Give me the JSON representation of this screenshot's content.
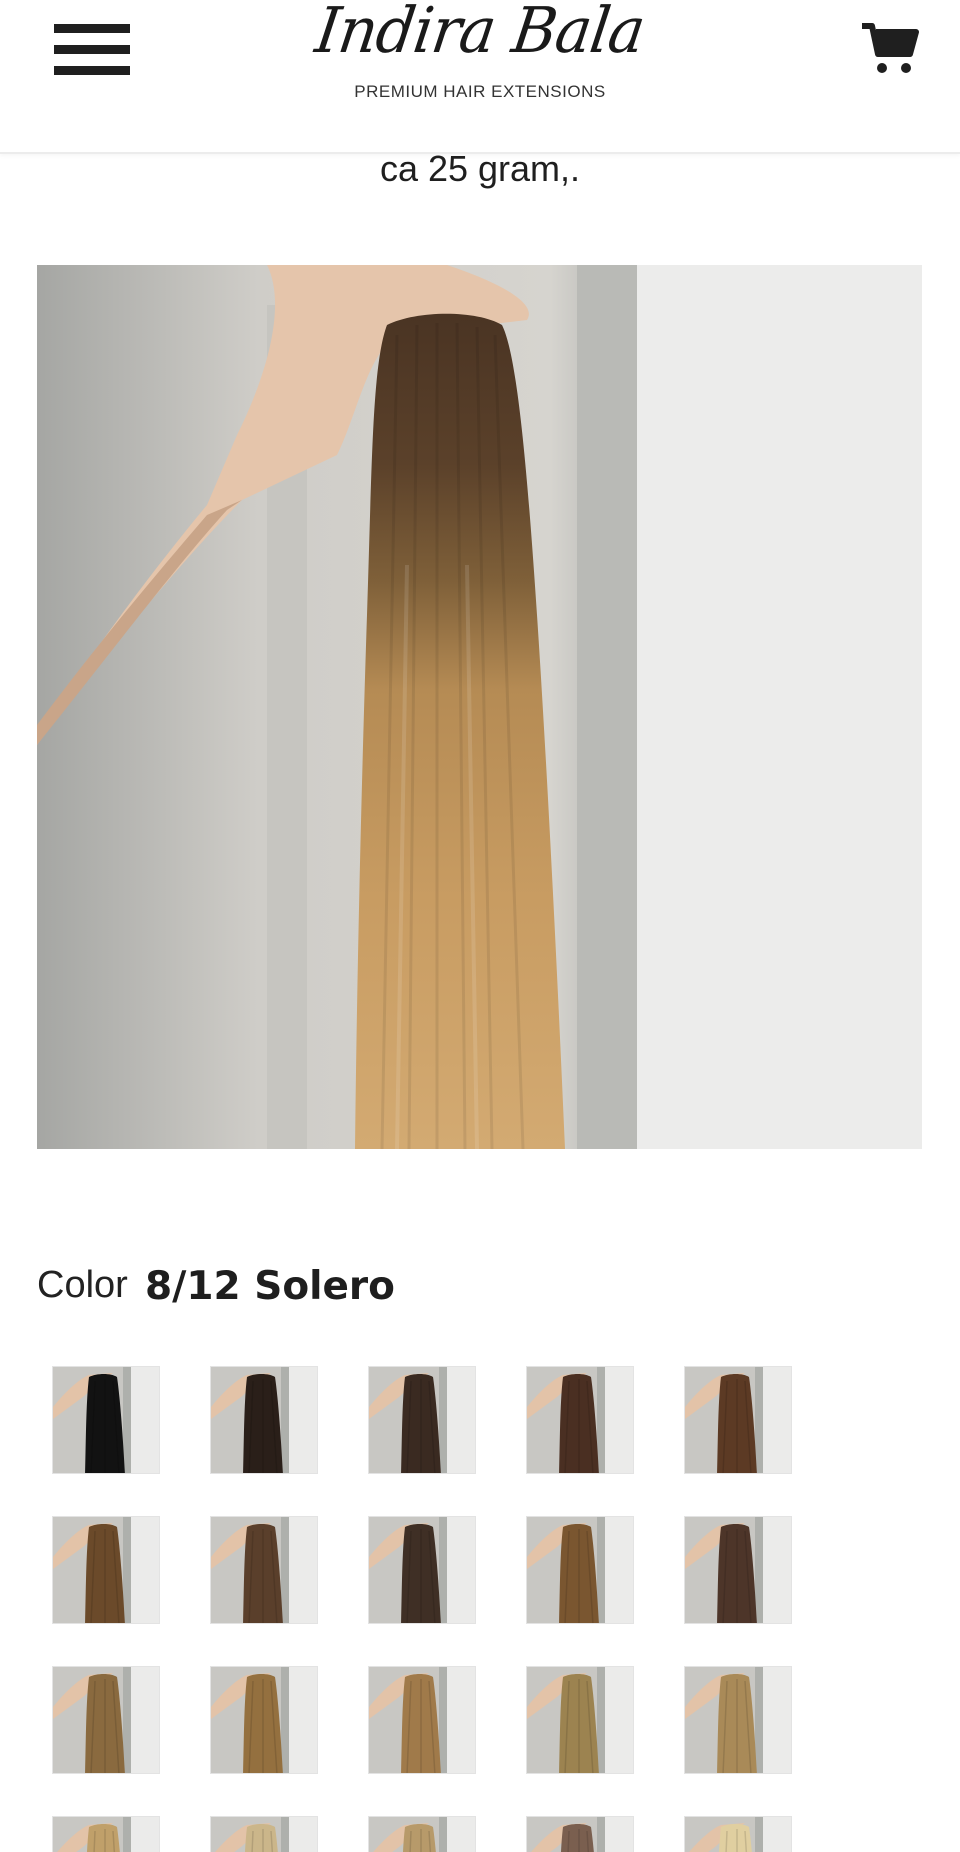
{
  "header": {
    "menu_icon": "hamburger-menu-icon",
    "logo_script": "Indira Bala",
    "logo_tagline": "PREMIUM HAIR EXTENSIONS",
    "cart_icon": "shopping-cart-icon"
  },
  "product": {
    "weight_text": "ca 25 gram,.",
    "color_label": "Color",
    "color_value": "8/12 Solero"
  },
  "swatch_colors": [
    [
      "#121212",
      "#2a1f19",
      "#3a2a21",
      "#4a2f22",
      "#5c3a24"
    ],
    [
      "#6b4a2a",
      "#5a3f2b",
      "#3f2f25",
      "#7a5630",
      "#4d3529"
    ],
    [
      "#8a6a3f",
      "#94703f",
      "#a07a4a",
      "#9c8350",
      "#a98a58"
    ],
    [
      "#c0a06a",
      "#cbb68a",
      "#b79a6a",
      "#7a5f4f",
      "#e0cfa0"
    ]
  ],
  "colors": {
    "text": "#222222",
    "header_border": "#ececec",
    "icon": "#1f1f1f"
  }
}
